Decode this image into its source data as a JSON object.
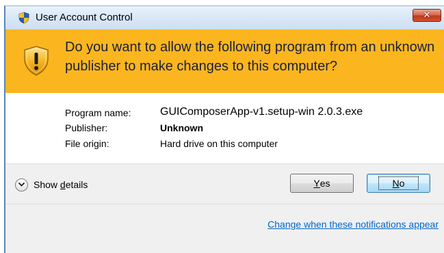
{
  "window": {
    "title": "User Account Control",
    "close_glyph": "✕"
  },
  "banner": {
    "question": "Do you want to allow the following program from an unknown publisher to make changes to this computer?",
    "icon": "uac-shield-warning-icon"
  },
  "details": {
    "program_label": "Program name:",
    "program_value": "GUIComposerApp-v1.setup-win  2.0.3.exe",
    "publisher_label": "Publisher:",
    "publisher_value": "Unknown",
    "origin_label": "File origin:",
    "origin_value": "Hard drive on this computer"
  },
  "actions": {
    "show_details_pre": "Show ",
    "show_details_acc": "d",
    "show_details_post": "etails",
    "yes_acc": "Y",
    "yes_rest": "es",
    "no_acc": "N",
    "no_rest": "o"
  },
  "footer": {
    "link_text": "Change when these notifications appear"
  },
  "colors": {
    "banner": "#fbb61f",
    "link": "#0066cc",
    "close_button": "#c0391b"
  }
}
